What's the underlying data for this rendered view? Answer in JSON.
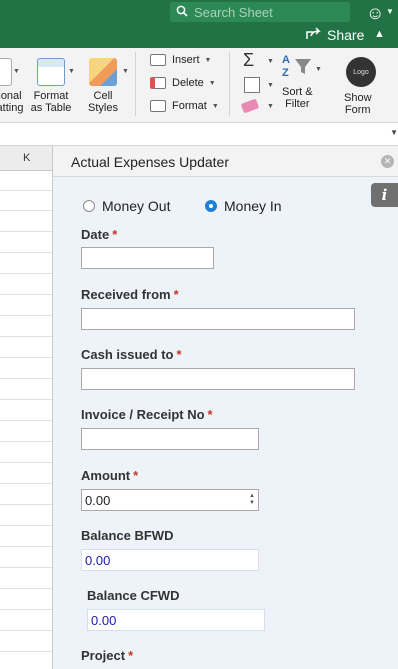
{
  "titlebar": {
    "search_placeholder": "Search Sheet",
    "share_label": "Share"
  },
  "ribbon": {
    "conditional_formatting_label": "ional\natting",
    "format_as_table_label": "Format\nas Table",
    "cell_styles_label": "Cell\nStyles",
    "insert_label": "Insert",
    "delete_label": "Delete",
    "format_label": "Format",
    "sort_filter_label": "Sort &\nFilter",
    "logo_text": "Logo",
    "show_form_label": "Show\nForm"
  },
  "sheet": {
    "column_header": "K"
  },
  "pane": {
    "title": "Actual Expenses Updater",
    "radio_money_out": "Money Out",
    "radio_money_in": "Money In",
    "selected": "Money In",
    "required_marker": "*",
    "fields": {
      "date": {
        "label": "Date",
        "value": ""
      },
      "received_from": {
        "label": "Received from",
        "value": ""
      },
      "cash_issued_to": {
        "label": "Cash issued to",
        "value": ""
      },
      "invoice_receipt": {
        "label": "Invoice / Receipt No",
        "value": ""
      },
      "amount": {
        "label": "Amount",
        "value": "0.00"
      },
      "balance_bfwd": {
        "label": "Balance BFWD",
        "value": "0.00"
      },
      "balance_cfwd": {
        "label": "Balance CFWD",
        "value": "0.00"
      },
      "project": {
        "label": "Project"
      }
    }
  },
  "colors": {
    "excel_green": "#217346",
    "radio_blue": "#1e7fd9",
    "required_red": "#c0392b",
    "readonly_value_blue": "#1a1ab0"
  }
}
